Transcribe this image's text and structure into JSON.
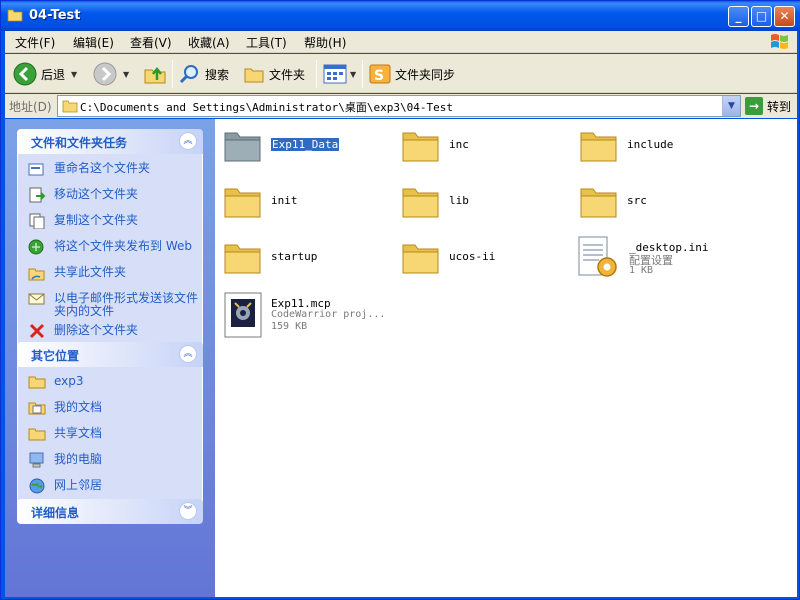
{
  "window": {
    "title": "04-Test",
    "min_glyph": "_",
    "max_glyph": "□",
    "close_glyph": "✕"
  },
  "menu": {
    "items": [
      "文件(F)",
      "编辑(E)",
      "查看(V)",
      "收藏(A)",
      "工具(T)",
      "帮助(H)"
    ]
  },
  "toolbar": {
    "back_label": "后退",
    "search_label": "搜索",
    "folders_label": "文件夹",
    "sync_label": "文件夹同步"
  },
  "address": {
    "label": "地址(D)",
    "value": "C:\\Documents and Settings\\Administrator\\桌面\\exp3\\04-Test",
    "go_label": "转到"
  },
  "tasks_panel": {
    "title": "文件和文件夹任务",
    "items": [
      {
        "label": "重命名这个文件夹",
        "icon": "rename-icon"
      },
      {
        "label": "移动这个文件夹",
        "icon": "move-icon"
      },
      {
        "label": "复制这个文件夹",
        "icon": "copy-icon"
      },
      {
        "label": "将这个文件夹发布到 Web",
        "icon": "publish-web-icon"
      },
      {
        "label": "共享此文件夹",
        "icon": "share-icon"
      },
      {
        "label": "以电子邮件形式发送该文件夹内的文件",
        "icon": "email-icon"
      },
      {
        "label": "删除这个文件夹",
        "icon": "delete-icon"
      }
    ]
  },
  "places_panel": {
    "title": "其它位置",
    "items": [
      {
        "label": "exp3",
        "icon": "folder-icon"
      },
      {
        "label": "我的文档",
        "icon": "my-documents-icon"
      },
      {
        "label": "共享文档",
        "icon": "shared-documents-icon"
      },
      {
        "label": "我的电脑",
        "icon": "my-computer-icon"
      },
      {
        "label": "网上邻居",
        "icon": "network-places-icon"
      }
    ]
  },
  "details_panel": {
    "title": "详细信息"
  },
  "files": [
    {
      "name": "Exp11_Data",
      "type": "folder-gray",
      "selected": true
    },
    {
      "name": "inc",
      "type": "folder"
    },
    {
      "name": "include",
      "type": "folder"
    },
    {
      "name": "init",
      "type": "folder"
    },
    {
      "name": "lib",
      "type": "folder"
    },
    {
      "name": "src",
      "type": "folder"
    },
    {
      "name": "startup",
      "type": "folder"
    },
    {
      "name": "ucos-ii",
      "type": "folder"
    },
    {
      "name": "_desktop.ini",
      "type": "ini",
      "sub1": "配置设置",
      "sub2": "1 KB"
    },
    {
      "name": "Exp11.mcp",
      "type": "mcp",
      "sub1": "CodeWarrior proj...",
      "sub2": "159 KB"
    }
  ],
  "colors": {
    "title_blue": "#0054e3",
    "pane_blue": "#7ba2e7",
    "link_blue": "#215dc6",
    "folder_yellow": "#f7d774",
    "selection": "#316ac5"
  }
}
